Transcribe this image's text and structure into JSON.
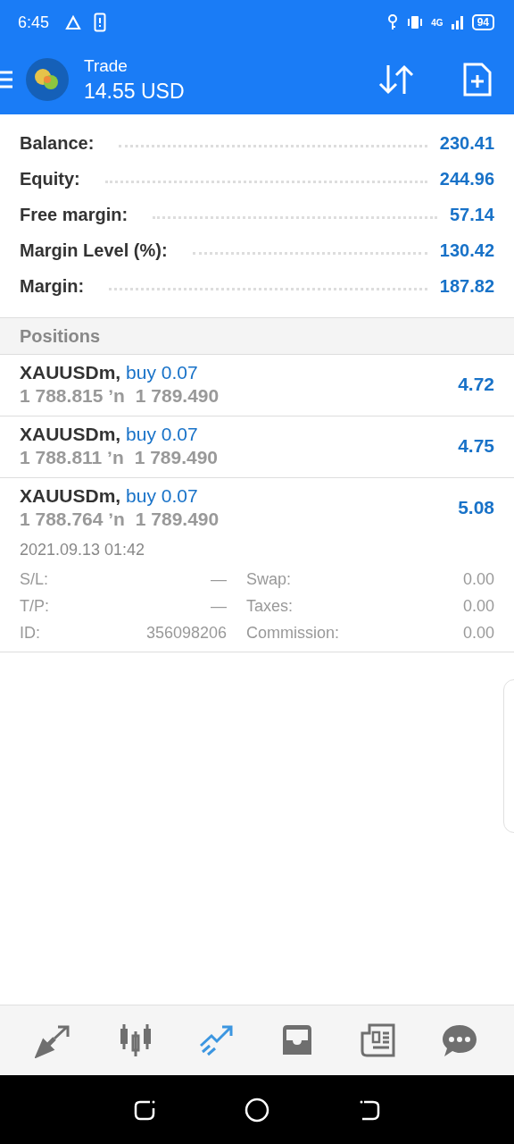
{
  "status_bar": {
    "time": "6:45",
    "battery": "94",
    "network": "4G"
  },
  "app_bar": {
    "title": "Trade",
    "subtitle": "14.55 USD"
  },
  "summary": [
    {
      "label": "Balance:",
      "value": "230.41"
    },
    {
      "label": "Equity:",
      "value": "244.96"
    },
    {
      "label": "Free margin:",
      "value": "57.14"
    },
    {
      "label": "Margin Level (%):",
      "value": "130.42"
    },
    {
      "label": "Margin:",
      "value": "187.82"
    }
  ],
  "positions_header": "Positions",
  "positions": [
    {
      "symbol": "XAUUSDm,",
      "side": "buy 0.07",
      "open_price": "1 788.815",
      "separator": "ʼn",
      "current_price": "1 789.490",
      "profit": "4.72"
    },
    {
      "symbol": "XAUUSDm,",
      "side": "buy 0.07",
      "open_price": "1 788.811",
      "separator": "ʼn",
      "current_price": "1 789.490",
      "profit": "4.75"
    },
    {
      "symbol": "XAUUSDm,",
      "side": "buy 0.07",
      "open_price": "1 788.764",
      "separator": "ʼn",
      "current_price": "1 789.490",
      "profit": "5.08",
      "time": "2021.09.13 01:42",
      "details": [
        {
          "label": "S/L:",
          "value": "—",
          "label_2": "Swap:",
          "value_2": "0.00"
        },
        {
          "label": "T/P:",
          "value": "—",
          "label_2": "Taxes:",
          "value_2": "0.00"
        },
        {
          "label": "ID:",
          "value": "356098206",
          "label_2": "Commission:",
          "value_2": "0.00"
        }
      ]
    }
  ],
  "bottom_nav": [
    {
      "kind": "quotes",
      "selected": false
    },
    {
      "kind": "chart",
      "selected": false
    },
    {
      "kind": "trade",
      "selected": true
    },
    {
      "kind": "history",
      "selected": false
    },
    {
      "kind": "news",
      "selected": false
    },
    {
      "kind": "chat",
      "selected": false
    }
  ]
}
